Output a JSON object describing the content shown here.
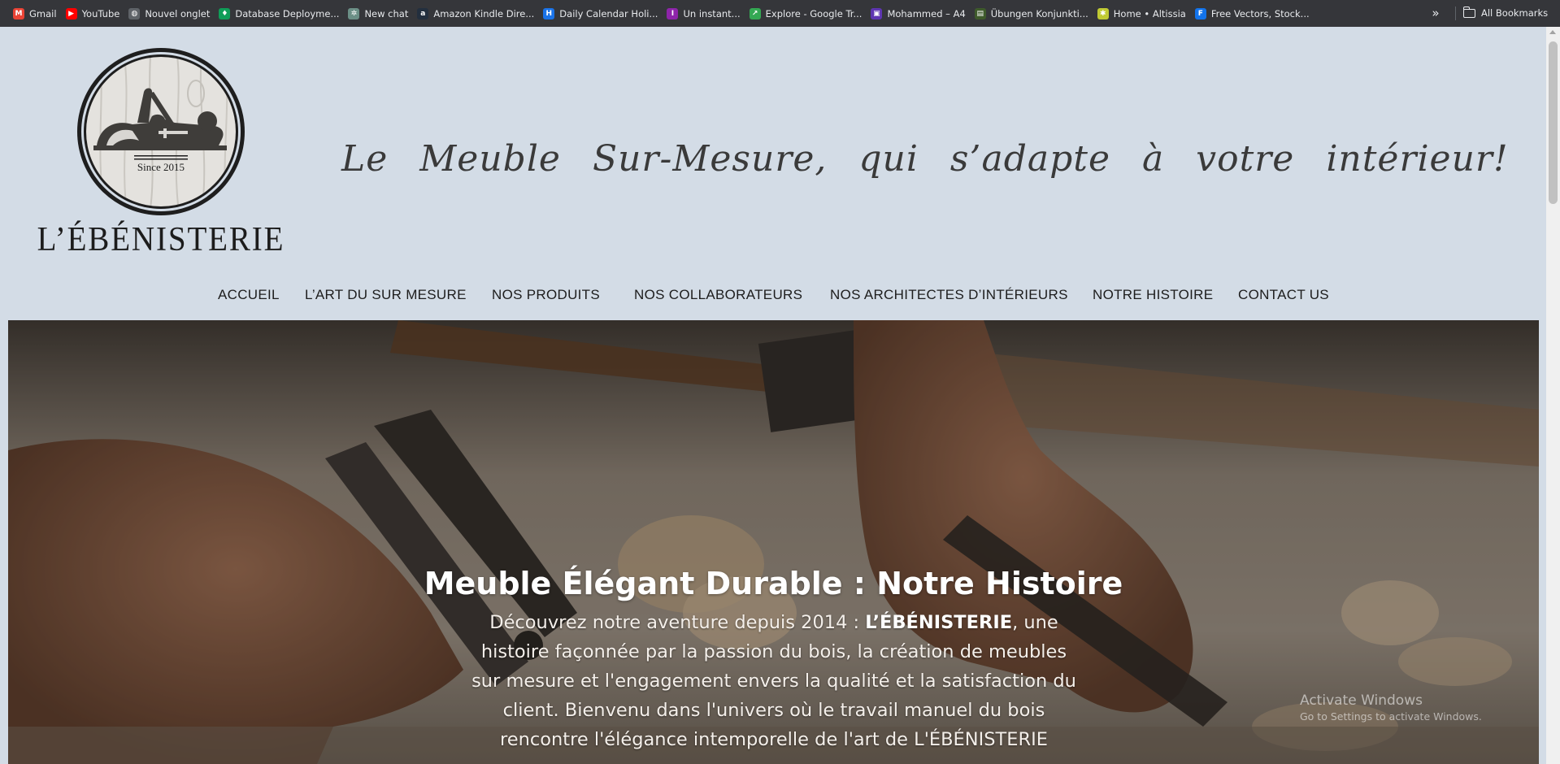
{
  "bookmarks": {
    "items": [
      {
        "label": "Gmail",
        "icon": "gmail-icon",
        "color": "#ea4335",
        "glyph": "M"
      },
      {
        "label": "YouTube",
        "icon": "youtube-icon",
        "color": "#ff0000",
        "glyph": "▶"
      },
      {
        "label": "Nouvel onglet",
        "icon": "globe-icon",
        "color": "#5f6368",
        "glyph": "◍"
      },
      {
        "label": "Database Deployme...",
        "icon": "leaf-icon",
        "color": "#0f9d58",
        "glyph": "♦"
      },
      {
        "label": "New chat",
        "icon": "chat-icon",
        "color": "#6b8f86",
        "glyph": "✲"
      },
      {
        "label": "Amazon Kindle Dire...",
        "icon": "amazon-icon",
        "color": "#232f3e",
        "glyph": "a"
      },
      {
        "label": "Daily Calendar Holi...",
        "icon": "calendar-icon",
        "color": "#1a73e8",
        "glyph": "H"
      },
      {
        "label": "Un instant...",
        "icon": "text-icon",
        "color": "#8e24aa",
        "glyph": "I"
      },
      {
        "label": "Explore - Google Tr...",
        "icon": "trends-icon",
        "color": "#34a853",
        "glyph": "↗"
      },
      {
        "label": "Mohammed – A4",
        "icon": "doc-icon",
        "color": "#5e35b1",
        "glyph": "▣"
      },
      {
        "label": "Übungen Konjunkti...",
        "icon": "exercise-icon",
        "color": "#3e5a2b",
        "glyph": "▤"
      },
      {
        "label": "Home • Altissia",
        "icon": "altissia-icon",
        "color": "#c0ca33",
        "glyph": "✱"
      },
      {
        "label": "Free Vectors, Stock...",
        "icon": "freepik-icon",
        "color": "#1273eb",
        "glyph": "F"
      }
    ],
    "more": "»",
    "all_bookmarks": "All Bookmarks"
  },
  "header": {
    "logo_since": "Since 2015",
    "logo_name": "L’ÉBÉNISTERIE",
    "tagline": "Le Meuble Sur-Mesure, qui s’adapte à votre intérieur!"
  },
  "nav": {
    "items": [
      "ACCUEIL",
      "L’ART DU SUR MESURE",
      "NOS PRODUITS",
      "NOS COLLABORATEURS",
      "NOS ARCHITECTES D’INTÉRIEURS",
      "NOTRE HISTOIRE",
      "CONTACT US"
    ]
  },
  "hero": {
    "title": "Meuble Élégant Durable : Notre Histoire",
    "text_before": "Découvrez notre aventure depuis 2014 : ",
    "text_brand": "L’ÉBÉNISTERIE",
    "text_after": ", une histoire façonnée par la passion du bois, la création de meubles sur mesure et l'engagement envers la qualité et la satisfaction du client. Bienvenu dans l'univers où le travail manuel du bois rencontre l'élégance intemporelle de l'art de L'ÉBÉNISTERIE"
  },
  "os_watermark": {
    "title": "Activate Windows",
    "subtitle": "Go to Settings to activate Windows."
  },
  "colors": {
    "page_background": "#d3dce6",
    "bookmarks_bar": "#35363a"
  }
}
